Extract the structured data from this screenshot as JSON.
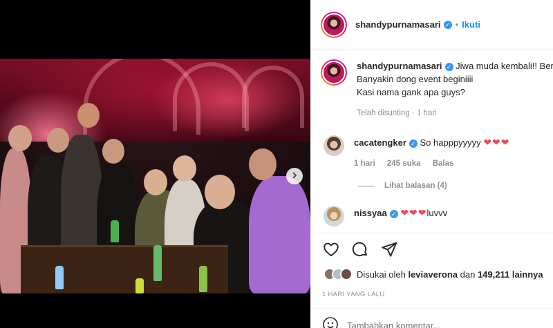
{
  "post": {
    "author": "shandypurnamasari",
    "follow_label": "Ikuti",
    "separator": "•"
  },
  "caption": {
    "author": "shandypurnamasari",
    "line1": "Jiwa muda kembali!! Bera",
    "line2": "Banyakin dong event beginiiii",
    "line3": "Kasi nama gank apa guys?",
    "meta": "Telah disunting · 1 hari"
  },
  "comments": [
    {
      "author": "cacatengker",
      "text": "So happpyyyyy",
      "emoji": "❤❤❤",
      "time": "1 hari",
      "likes": "245 suka",
      "reply_label": "Balas",
      "view_replies": "Lihat balasan (4)"
    },
    {
      "author": "nissyaa",
      "emoji": "❤❤❤",
      "text": "luvvv"
    }
  ],
  "likes": {
    "prefix": "Disukai oleh",
    "user": "leviaverona",
    "conj": "dan",
    "count": "149,211 lainnya"
  },
  "date": "1 HARI YANG LALU",
  "add_comment": {
    "placeholder": "Tambahkan komentar..."
  },
  "icons": {
    "like": "heart-outline-icon",
    "comment": "comment-bubble-icon",
    "share": "paper-plane-icon",
    "next": "chevron-right-icon",
    "emoji": "smiley-icon",
    "verified": "verified-badge-icon"
  },
  "colors": {
    "accent": "#0095f6",
    "verified": "#3897f0",
    "heart": "#ed4956",
    "muted": "#8e8e8e"
  }
}
